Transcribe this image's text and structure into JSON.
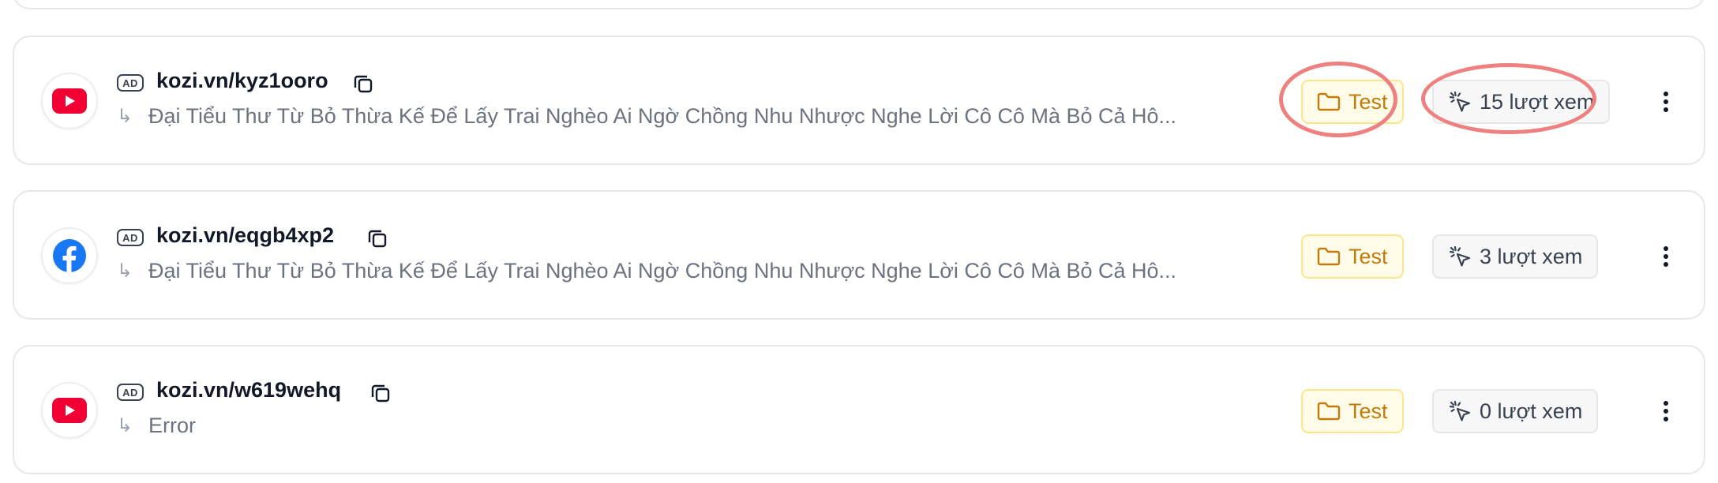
{
  "links": [
    {
      "platform": "youtube-icon",
      "ad_badge": "AD",
      "short_link": "kozi.vn/kyz1ooro",
      "arrow": "↳",
      "title": "Đại Tiểu Thư Từ Bỏ Thừa Kế Để Lấy Trai Nghèo Ai Ngờ Chồng Nhu Nhược Nghe Lời Cô Cô Mà Bỏ Cả Hô...",
      "folder": "Test",
      "views": "15 lượt xem"
    },
    {
      "platform": "facebook-icon",
      "ad_badge": "AD",
      "short_link": "kozi.vn/eqgb4xp2",
      "arrow": "↳",
      "title": "Đại Tiểu Thư Từ Bỏ Thừa Kế Để Lấy Trai Nghèo Ai Ngờ Chồng Nhu Nhược Nghe Lời Cô Cô Mà Bỏ Cả Hô...",
      "folder": "Test",
      "views": "3 lượt xem"
    },
    {
      "platform": "youtube-icon",
      "ad_badge": "AD",
      "short_link": "kozi.vn/w619wehq",
      "arrow": "↳",
      "title": "Error",
      "folder": "Test",
      "views": "0 lượt xem"
    }
  ],
  "colors": {
    "youtube": "#f00033",
    "facebook": "#1877f2",
    "folder_text": "#c47a0b",
    "folder_bg": "#fefce8",
    "annotation": "#ef8080"
  }
}
